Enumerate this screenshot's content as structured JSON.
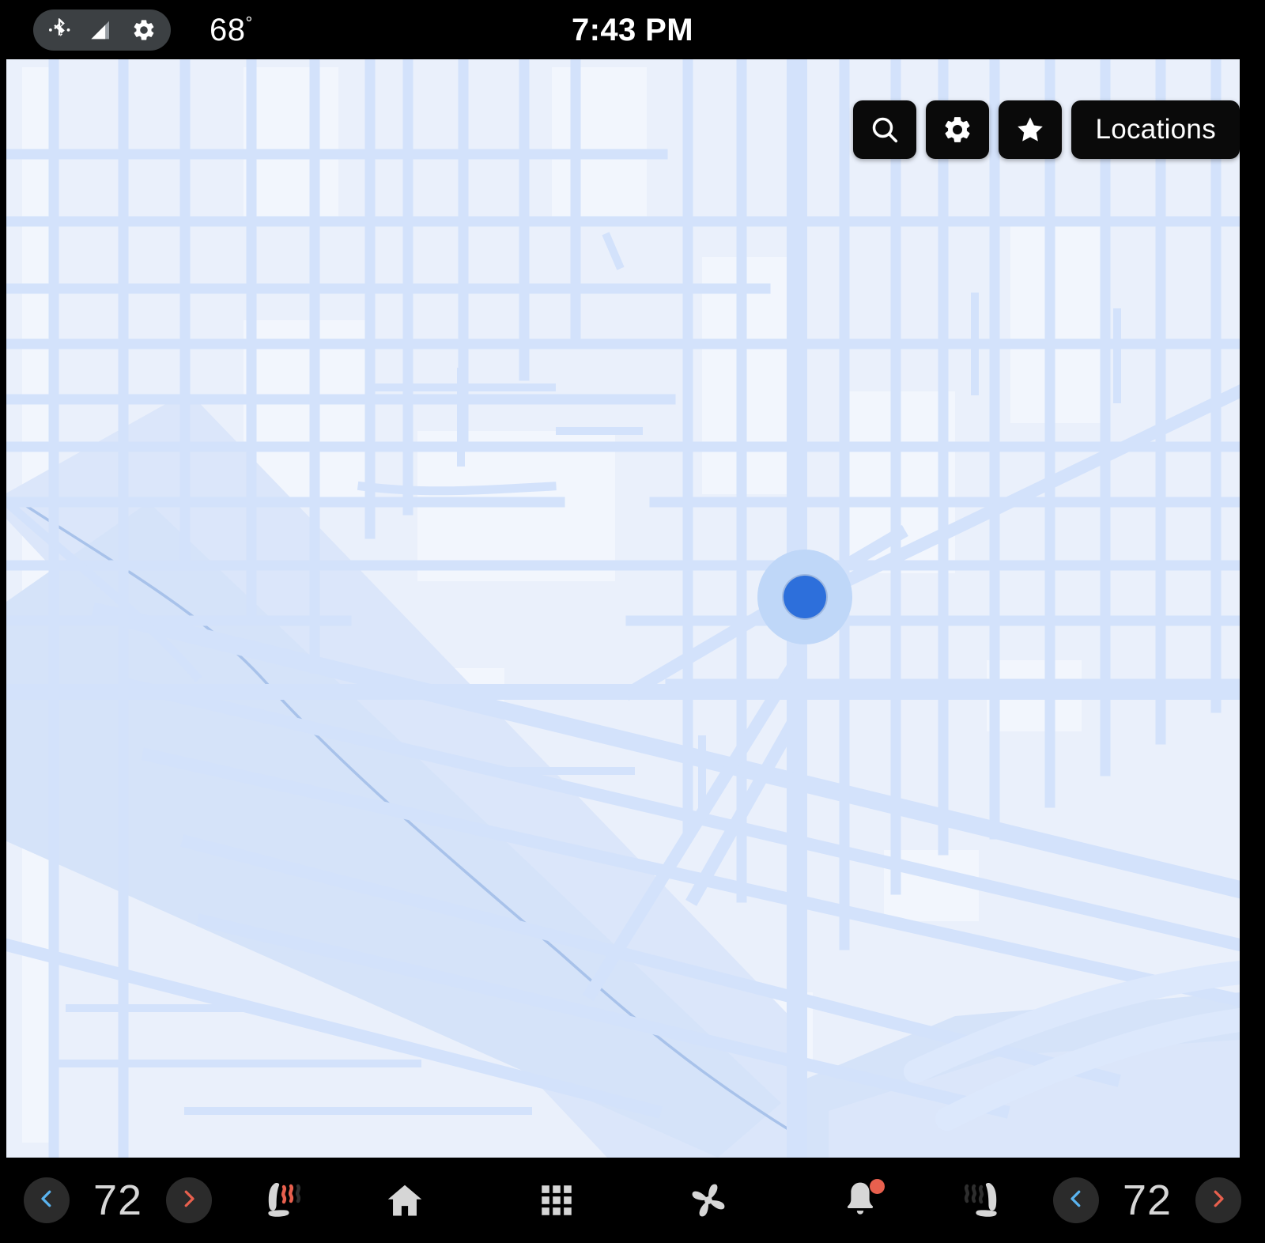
{
  "status_bar": {
    "icons": [
      {
        "name": "bluetooth-icon",
        "label": "Bluetooth"
      },
      {
        "name": "cellular-signal-icon",
        "label": "Signal"
      },
      {
        "name": "gear-icon",
        "label": "Settings"
      }
    ],
    "outside_temperature": "68",
    "degree_symbol": "°",
    "clock": "7:43 PM",
    "pill_color": "#3c4043",
    "background": "#000000",
    "text_color": "#ffffff"
  },
  "map": {
    "background_color": "#eaf0fb",
    "road_color": "#d3e2fb",
    "highway_color": "#dce8fc",
    "water_color": "#d5e3f9",
    "block_color": "#f2f6fd",
    "river_line_color": "#a8c2ea",
    "marker": {
      "name": "current-location-marker",
      "dot_color": "#2d6fdb",
      "halo_color": "#bfd7f8"
    },
    "controls": [
      {
        "name": "search-button",
        "icon": "search-icon",
        "label": ""
      },
      {
        "name": "map-settings-button",
        "icon": "gear-icon",
        "label": ""
      },
      {
        "name": "favorites-button",
        "icon": "star-icon",
        "label": ""
      },
      {
        "name": "locations-button",
        "icon": "",
        "label": "Locations"
      }
    ],
    "control_background": "#0a0a0a",
    "control_text_color": "#ffffff"
  },
  "climate_bar": {
    "background": "#000000",
    "driver": {
      "decrease_label": "‹",
      "temperature": "72",
      "increase_label": "›",
      "seat_heater": {
        "name": "driver-seat-heater-button",
        "active_waves": 2,
        "total_waves": 3,
        "active_color": "#e8604e",
        "inactive_color": "#2e2e2e",
        "seat_color": "#d6d6d6"
      }
    },
    "passenger": {
      "decrease_label": "‹",
      "temperature": "72",
      "increase_label": "›",
      "seat_heater": {
        "name": "passenger-seat-heater-button",
        "active_waves": 0,
        "total_waves": 3,
        "active_color": "#e8604e",
        "inactive_color": "#2e2e2e",
        "seat_color": "#d6d6d6"
      }
    },
    "decrease_arrow_color": "#5ab4f0",
    "increase_arrow_color": "#e8604e",
    "round_button_color": "#2b2b2b",
    "temperature_text_color": "#d6d6d6",
    "nav_items": [
      {
        "name": "home-button",
        "icon": "home-icon",
        "label": "Home",
        "badge": false
      },
      {
        "name": "apps-button",
        "icon": "grid-apps-icon",
        "label": "Apps",
        "badge": false
      },
      {
        "name": "climate-button",
        "icon": "fan-icon",
        "label": "Climate",
        "badge": false
      },
      {
        "name": "notifications-button",
        "icon": "bell-icon",
        "label": "Notifications",
        "badge": true
      }
    ],
    "nav_icon_color": "#d6d6d6",
    "badge_color": "#e8604e"
  }
}
